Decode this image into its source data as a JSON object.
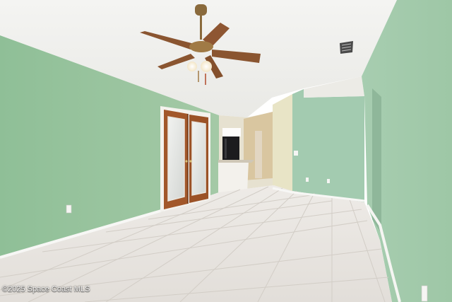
{
  "photo": {
    "watermark": "©2025 Space Coast MLS",
    "colors": {
      "wall_green": "#9ec7a4",
      "ceiling": "#f3f2ee",
      "floor_tile": "#e9e6e2",
      "door_wood": "#a2572a",
      "fan_wood": "#8a5530"
    }
  }
}
